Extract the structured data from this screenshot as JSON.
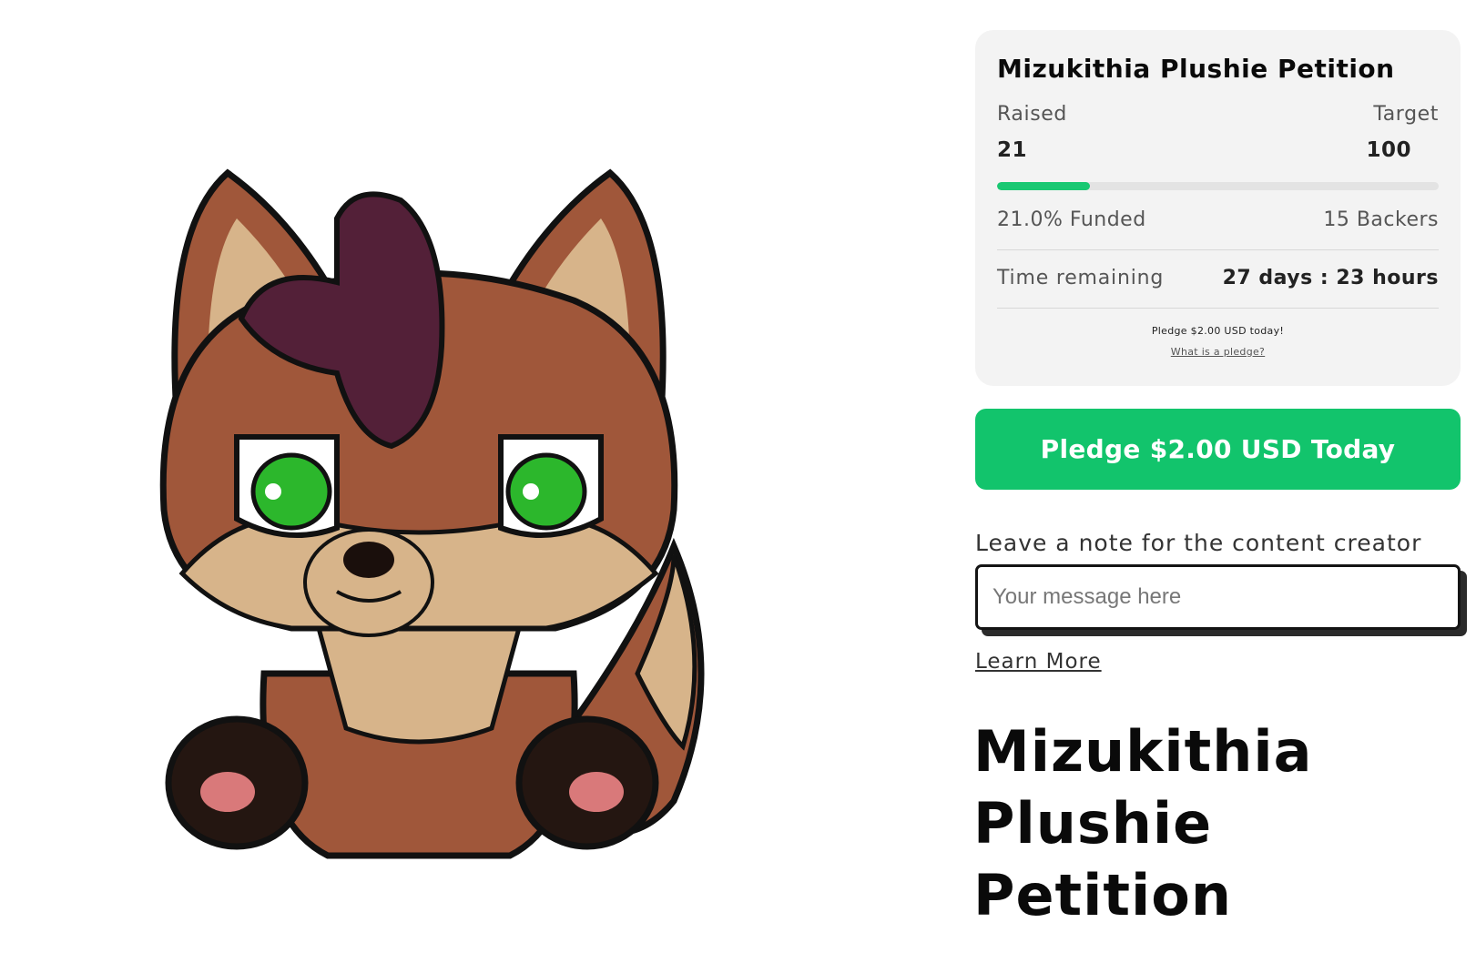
{
  "campaign": {
    "card_title": "Mizukithia Plushie Petition",
    "raised_label": "Raised",
    "target_label": "Target",
    "raised_value": "21",
    "target_value": "100",
    "progress_fraction": 0.21,
    "funded_text": "21.0% Funded",
    "backers_text": "15 Backers",
    "time_label": "Time remaining",
    "time_value": "27 days : 23 hours",
    "pledge_note": "Pledge $2.00 USD today!",
    "pledge_help_link": "What is a pledge?"
  },
  "pledge_button": {
    "label": "Pledge $2.00 USD Today"
  },
  "note": {
    "label": "Leave a note for the content creator",
    "placeholder": "Your message here",
    "value": ""
  },
  "learn_more": "Learn More",
  "main_title": "Mizukithia Plushie Petition",
  "colors": {
    "accent_green": "#12c46c",
    "card_bg": "#f3f3f3",
    "progress_track": "#e3e3e3"
  }
}
